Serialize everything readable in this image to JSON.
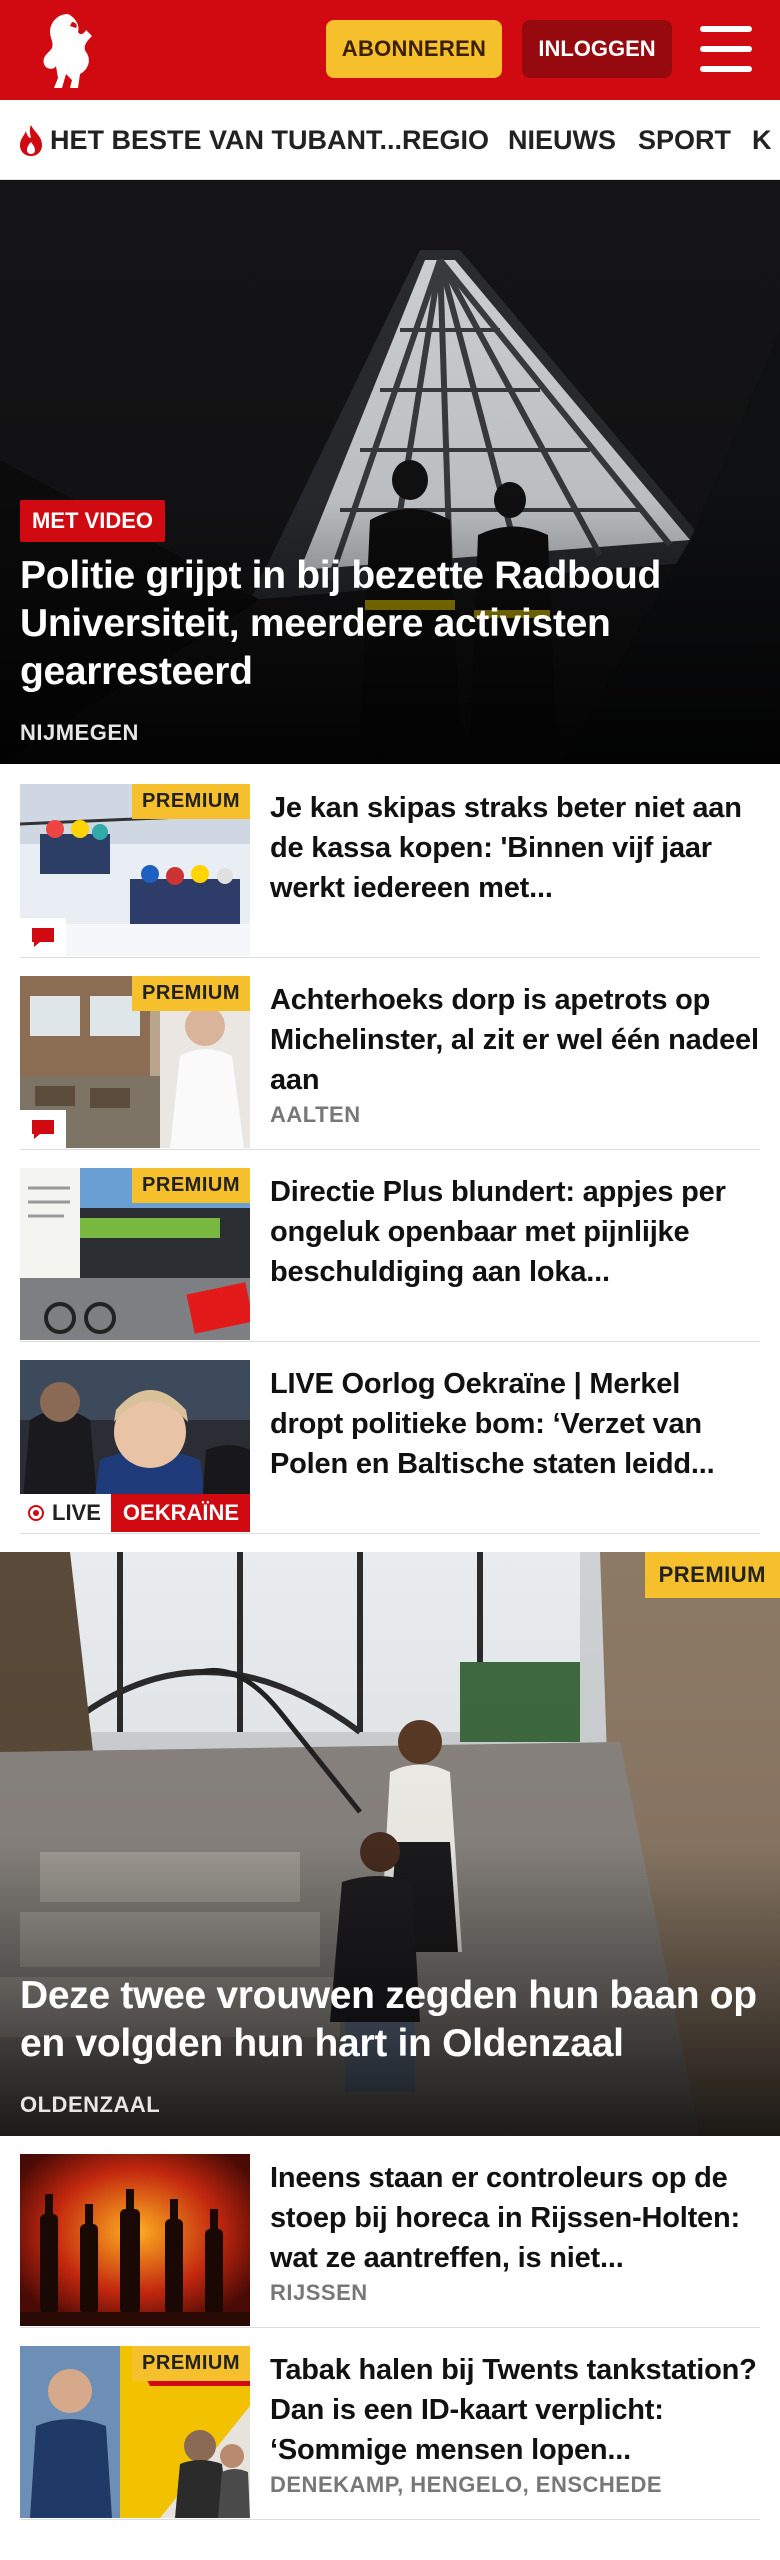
{
  "header": {
    "subscribe_label": "ABONNEREN",
    "login_label": "INLOGGEN",
    "brand_color": "#d10a11",
    "accent_color": "#f5c02b"
  },
  "nav": {
    "items": [
      {
        "label": "HET BESTE VAN TUBANT...",
        "icon": "flame-icon"
      },
      {
        "label": "REGIO"
      },
      {
        "label": "NIEUWS"
      },
      {
        "label": "SPORT"
      },
      {
        "label": "K"
      }
    ]
  },
  "hero": {
    "tag": "MET VIDEO",
    "title": "Politie grijpt in bij bezette Radboud Universiteit, meerdere activisten gearresteerd",
    "location": "NIJMEGEN"
  },
  "articles": [
    {
      "premium": "PREMIUM",
      "title": "Je kan skipas straks beter niet aan de kassa kopen: 'Binnen vijf jaar werkt iedereen met...",
      "location": "",
      "comment_icon": "comment-icon"
    },
    {
      "premium": "PREMIUM",
      "title": "Achterhoeks dorp is apetrots op Michelinster, al zit er wel één nadeel aan",
      "location": "AALTEN",
      "comment_icon": "comment-icon"
    },
    {
      "premium": "PREMIUM",
      "title": "Directie Plus blundert: appjes per ongeluk openbaar met pijnlijke beschuldiging aan loka...",
      "location": ""
    },
    {
      "live": "LIVE",
      "live_tag": "OEKRAÏNE",
      "title": "LIVE Oorlog Oekraïne | Merkel dropt politieke bom: ‘Verzet van Polen en Baltische staten leidd...",
      "location": ""
    }
  ],
  "feature": {
    "premium": "PREMIUM",
    "title": "Deze twee vrouwen zegden hun baan op en volgden hun hart in Oldenzaal",
    "location": "OLDENZAAL"
  },
  "articles2": [
    {
      "title": "Ineens staan er controleurs op de stoep bij horeca in Rijssen-Hol­ten: wat ze aantreffen, is niet...",
      "location": "RIJSSEN"
    },
    {
      "premium": "PREMIUM",
      "title": "Tabak halen bij Twents tankstati­on? Dan is een ID-kaart verplicht: ‘Sommige mensen lopen...",
      "location": "DENEKAMP, HENGELO, ENSCHEDE"
    }
  ]
}
